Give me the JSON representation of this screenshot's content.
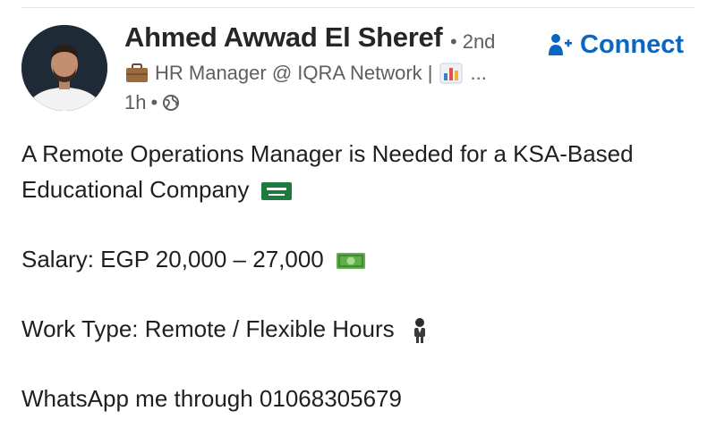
{
  "author": {
    "name": "Ahmed Awwad El Sheref",
    "degree_sep": "•",
    "degree": "2nd",
    "headline": "HR Manager @ IQRA Network |",
    "headline_ellipsis": "...",
    "time": "1h",
    "time_sep": "•",
    "visibility_icon": "globe-icon",
    "headline_icons": [
      "briefcase-icon",
      "bar-chart-icon"
    ]
  },
  "connect": {
    "label": "Connect",
    "icon": "add-person-icon",
    "color": "#0a66c2"
  },
  "post": {
    "line1": "A Remote Operations Manager is Needed for a KSA-Based",
    "line2": "Educational Company",
    "salary": "Salary: EGP 20,000 – 27,000",
    "work_type": "Work Type: Remote / Flexible Hours",
    "contact": "WhatsApp me through 01068305679",
    "emojis": [
      "saudi-flag-icon",
      "money-icon",
      "person-in-suit-icon"
    ]
  }
}
